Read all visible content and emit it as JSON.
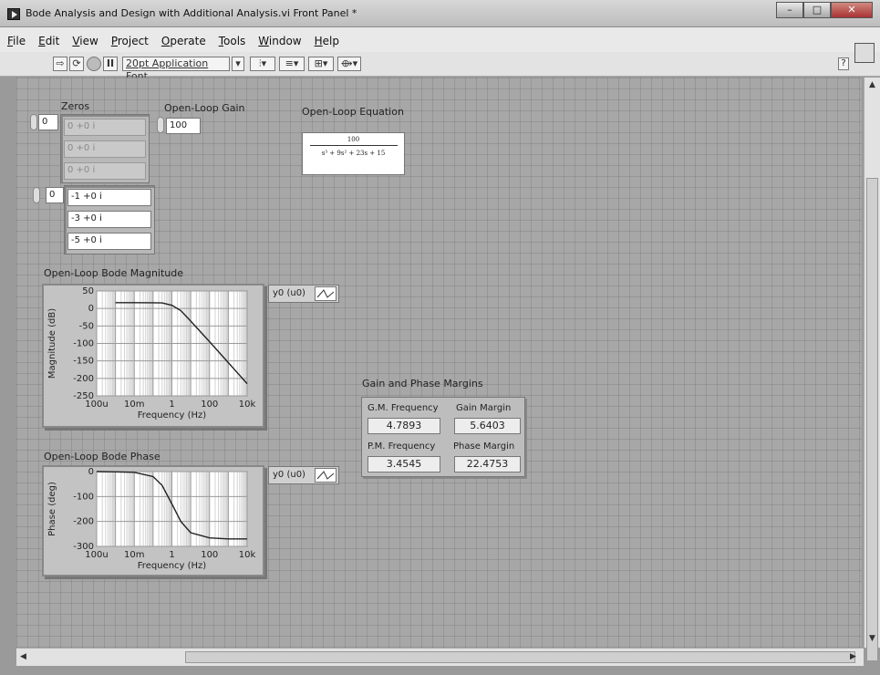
{
  "window": {
    "title": "Bode Analysis and Design with Additional Analysis.vi Front Panel *"
  },
  "menu": [
    "File",
    "Edit",
    "View",
    "Project",
    "Operate",
    "Tools",
    "Window",
    "Help"
  ],
  "toolbar": {
    "font": "20pt Application Font"
  },
  "zeros": {
    "label": "Zeros",
    "index": "0",
    "values": [
      "0 +0 i",
      "0 +0 i",
      "0 +0 i"
    ]
  },
  "poles": {
    "index": "0",
    "values": [
      "-1 +0 i",
      "-3 +0 i",
      "-5 +0 i"
    ]
  },
  "gain": {
    "label": "Open-Loop Gain",
    "value": "100"
  },
  "equation": {
    "label": "Open-Loop Equation",
    "numerator": "100",
    "denominator": "s³ + 9s² + 23s + 15"
  },
  "magnitude_plot": {
    "title": "Open-Loop Bode Magnitude",
    "legend": "y0 (u0)",
    "ylabel": "Magnitude (dB)",
    "xlabel": "Frequency (Hz)",
    "yticks": [
      "50",
      "0",
      "-50",
      "-100",
      "-150",
      "-200",
      "-250"
    ],
    "xticks": [
      "100u",
      "10m",
      "1",
      "100",
      "10k"
    ]
  },
  "phase_plot": {
    "title": "Open-Loop Bode Phase",
    "legend": "y0 (u0)",
    "ylabel": "Phase (deg)",
    "xlabel": "Frequency (Hz)",
    "yticks": [
      "0",
      "-100",
      "-200",
      "-300"
    ],
    "xticks": [
      "100u",
      "10m",
      "1",
      "100",
      "10k"
    ]
  },
  "margins": {
    "title": "Gain and Phase Margins",
    "gm_freq_label": "G.M. Frequency",
    "gm_label": "Gain Margin",
    "pm_freq_label": "P.M. Frequency",
    "pm_label": "Phase Margin",
    "gm_freq": "4.7893",
    "gm": "5.6403",
    "pm_freq": "3.4545",
    "pm": "22.4753"
  },
  "chart_data": [
    {
      "type": "line",
      "xscale": "log",
      "xlim": [
        0.0001,
        10000
      ],
      "ylim": [
        -250,
        50
      ],
      "series": [
        {
          "x": [
            0.001,
            0.01,
            0.1,
            0.3,
            1,
            3,
            10,
            100,
            1000,
            10000
          ],
          "values": [
            16.5,
            16.5,
            16.4,
            15.9,
            9,
            -6,
            -36,
            -95,
            -155,
            -215
          ]
        }
      ]
    },
    {
      "type": "line",
      "xscale": "log",
      "xlim": [
        0.0001,
        10000
      ],
      "ylim": [
        -300,
        0
      ],
      "series": [
        {
          "x": [
            0.0001,
            0.001,
            0.01,
            0.1,
            0.3,
            1,
            3,
            10,
            100,
            1000,
            10000
          ],
          "values": [
            0,
            -1,
            -3,
            -20,
            -55,
            -130,
            -200,
            -245,
            -266,
            -270,
            -270
          ]
        }
      ]
    }
  ]
}
